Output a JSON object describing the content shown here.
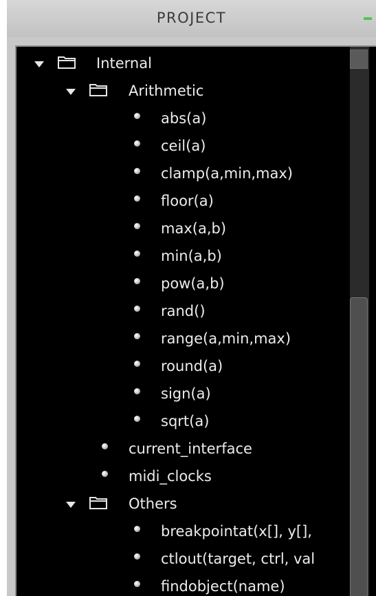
{
  "panel": {
    "title": "PROJECT"
  },
  "tree": {
    "internal": {
      "label": "Internal"
    },
    "arithmetic": {
      "label": "Arithmetic",
      "items": [
        "abs(a)",
        "ceil(a)",
        "clamp(a,min,max)",
        "floor(a)",
        "max(a,b)",
        "min(a,b)",
        "pow(a,b)",
        "rand()",
        "range(a,min,max)",
        "round(a)",
        "sign(a)",
        "sqrt(a)"
      ]
    },
    "internal_items": [
      "current_interface",
      "midi_clocks"
    ],
    "others": {
      "label": "Others",
      "items": [
        "breakpointat(x[], y[],",
        "ctlout(target, ctrl, val",
        "findobject(name)"
      ]
    }
  },
  "colors": {
    "tree_background": "#000000",
    "text": "#ececec",
    "title_text": "#3b3b3b",
    "accent": "#52c64a"
  }
}
